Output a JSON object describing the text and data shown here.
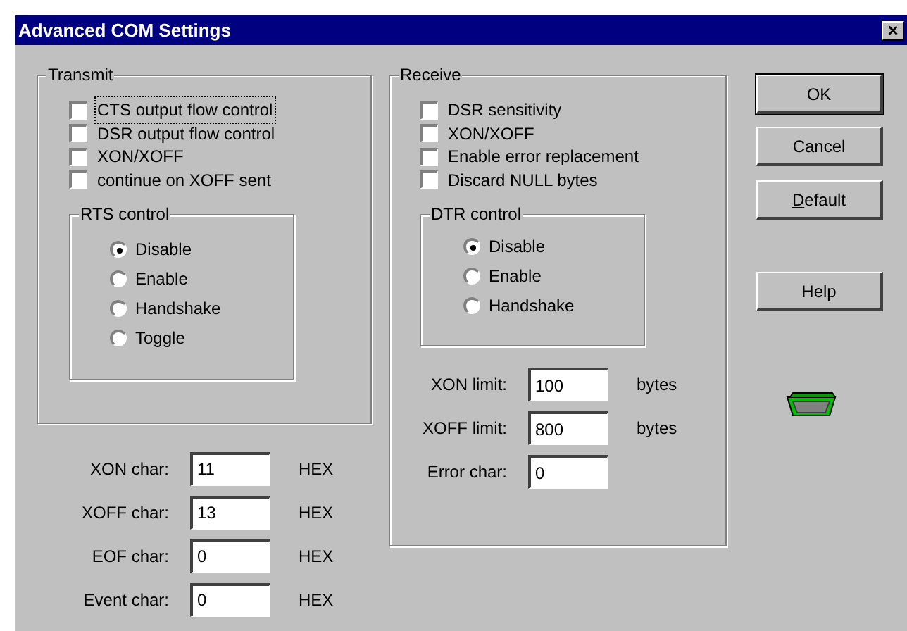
{
  "window": {
    "title": "Advanced COM Settings",
    "close": "×"
  },
  "transmit": {
    "title": "Transmit",
    "options": [
      {
        "label": "CTS output flow control",
        "checked": false,
        "focused": true
      },
      {
        "label": "DSR output flow control",
        "checked": false,
        "focused": false
      },
      {
        "label": "XON/XOFF",
        "checked": false,
        "focused": false
      },
      {
        "label": "continue on XOFF sent",
        "checked": false,
        "focused": false
      }
    ],
    "rts": {
      "title": "RTS control",
      "options": [
        {
          "label": "Disable",
          "selected": true
        },
        {
          "label": "Enable",
          "selected": false
        },
        {
          "label": "Handshake",
          "selected": false
        },
        {
          "label": "Toggle",
          "selected": false
        }
      ]
    }
  },
  "chars": [
    {
      "label": "XON char:",
      "value": "11",
      "unit": "HEX"
    },
    {
      "label": "XOFF char:",
      "value": "13",
      "unit": "HEX"
    },
    {
      "label": "EOF char:",
      "value": "0",
      "unit": "HEX"
    },
    {
      "label": "Event char:",
      "value": "0",
      "unit": "HEX"
    }
  ],
  "receive": {
    "title": "Receive",
    "options": [
      {
        "label": "DSR sensitivity",
        "checked": false,
        "focused": false
      },
      {
        "label": "XON/XOFF",
        "checked": false,
        "focused": false
      },
      {
        "label": "Enable error replacement",
        "checked": false,
        "focused": false
      },
      {
        "label": "Discard NULL bytes",
        "checked": false,
        "focused": false
      }
    ],
    "dtr": {
      "title": "DTR control",
      "options": [
        {
          "label": "Disable",
          "selected": true
        },
        {
          "label": "Enable",
          "selected": false
        },
        {
          "label": "Handshake",
          "selected": false
        }
      ]
    },
    "fields": [
      {
        "label": "XON limit:",
        "value": "100",
        "unit": "bytes"
      },
      {
        "label": "XOFF limit:",
        "value": "800",
        "unit": "bytes"
      },
      {
        "label": "Error char:",
        "value": "0"
      }
    ]
  },
  "buttons": [
    {
      "label": "OK",
      "default": true,
      "first_letter_underlined": false
    },
    {
      "label": "Cancel",
      "default": false,
      "first_letter_underlined": false
    },
    {
      "label": "Default",
      "default": false,
      "first_letter_underlined": true
    },
    {
      "label": "Help",
      "default": false,
      "first_letter_underlined": false
    }
  ]
}
